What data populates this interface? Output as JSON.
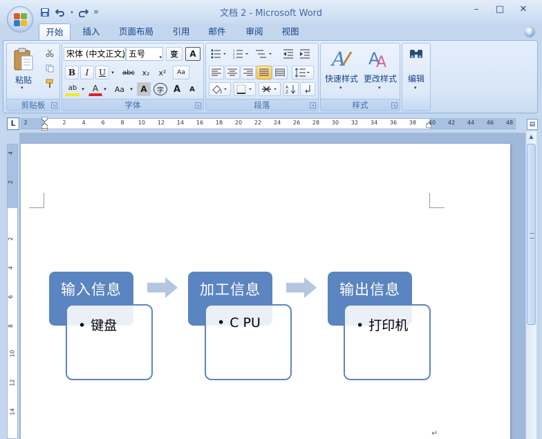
{
  "window": {
    "title": "文档 2 - Microsoft Word",
    "minimize": "–",
    "maximize": "□",
    "close": "✕"
  },
  "quick_access": [
    "save-icon",
    "undo-icon",
    "redo-icon",
    "customize-icon"
  ],
  "tabs": [
    {
      "label": "开始",
      "active": true
    },
    {
      "label": "插入"
    },
    {
      "label": "页面布局"
    },
    {
      "label": "引用"
    },
    {
      "label": "邮件"
    },
    {
      "label": "审阅"
    },
    {
      "label": "视图"
    }
  ],
  "ribbon": {
    "clipboard": {
      "label": "剪贴板",
      "paste": "粘贴"
    },
    "font": {
      "label": "字体",
      "font_name": "宋体 (中文正文)",
      "font_size": "五号",
      "phonetic": "变",
      "border": "A",
      "bold": "B",
      "italic": "I",
      "underline": "U",
      "strike": "abc",
      "sub": "x₂",
      "sup": "x²",
      "clear": "Aa",
      "highlight": "ab",
      "color": "A",
      "case": "Aa",
      "shade": "A",
      "enclose": "字",
      "grow": "A",
      "shrink": "A"
    },
    "paragraph": {
      "label": "段落"
    },
    "styles": {
      "label": "样式",
      "quick": "快速样式",
      "change": "更改样式"
    },
    "editing": {
      "label": "编辑"
    }
  },
  "ruler": {
    "h_numbers": [
      "2",
      "2",
      "4",
      "6",
      "8",
      "10",
      "12",
      "14",
      "16",
      "18",
      "20",
      "22",
      "24",
      "26",
      "28",
      "30",
      "32",
      "34",
      "36",
      "38",
      "40",
      "42",
      "44",
      "46",
      "48"
    ],
    "v_numbers": [
      "4",
      "2",
      "2",
      "4",
      "6",
      "8",
      "10",
      "12",
      "14"
    ],
    "corner": "L"
  },
  "smartart": {
    "steps": [
      {
        "header": "输入信息",
        "item": "键盘"
      },
      {
        "header": "加工信息",
        "item": "C PU"
      },
      {
        "header": "输出信息",
        "item": "打印机"
      }
    ]
  },
  "document": {
    "paragraph_mark": "↵"
  },
  "colors": {
    "accent": "#5b85c0",
    "arrow": "#b4c6e0",
    "ribbon_bg": "#dde9f8"
  }
}
